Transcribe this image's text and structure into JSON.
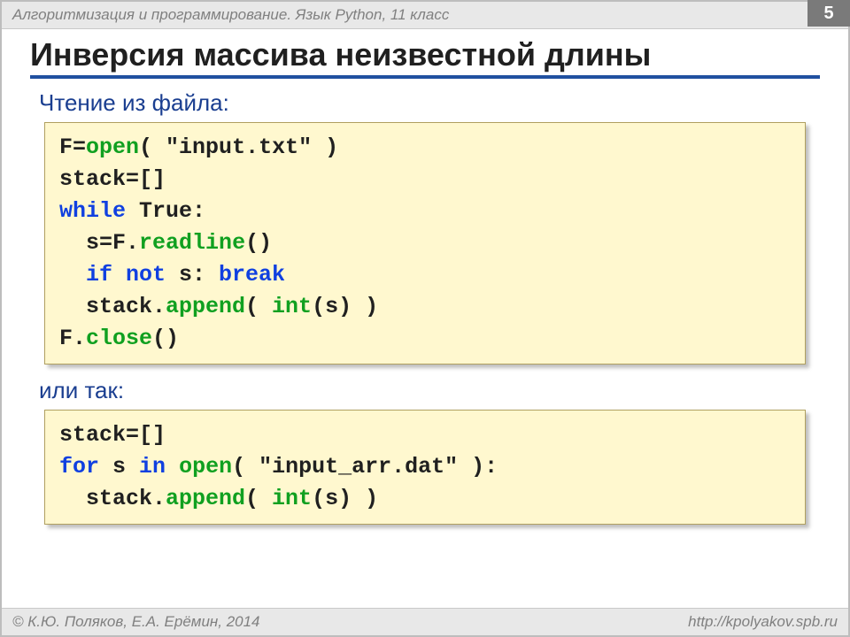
{
  "header": {
    "course": "Алгоритмизация и программирование. Язык Python, 11 класс",
    "page": "5"
  },
  "title": "Инверсия массива неизвестной длины",
  "caption1": "Чтение из файла:",
  "code1": {
    "l1a": "F",
    "l1eq": "=",
    "l1b": "open",
    "l1c": "( \"input.txt\" )",
    "l2a": "stack",
    "l2eq": "=",
    "l2b": "[]",
    "l3a": "while",
    "l3b": " True:",
    "l4a": "s",
    "l4eq": "=",
    "l4b": "F.",
    "l4c": "readline",
    "l4d": "()",
    "l5a": "if not",
    "l5b": " s: ",
    "l5c": "break",
    "l6a": "stack.",
    "l6b": "append",
    "l6c": "( ",
    "l6d": "int",
    "l6e": "(s) )",
    "l7a": "F.",
    "l7b": "close",
    "l7c": "()"
  },
  "caption2": "или так:",
  "code2": {
    "l1a": "stack",
    "l1eq": "=",
    "l1b": "[]",
    "l2a": "for",
    "l2b": " s ",
    "l2c": "in",
    "l2d": " ",
    "l2e": "open",
    "l2f": "( \"input_arr.dat\" ):",
    "l3a": "stack.",
    "l3b": "append",
    "l3c": "( ",
    "l3d": "int",
    "l3e": "(s) )"
  },
  "footer": {
    "left": "© К.Ю. Поляков, Е.А. Ерёмин, 2014",
    "right": "http://kpolyakov.spb.ru"
  }
}
